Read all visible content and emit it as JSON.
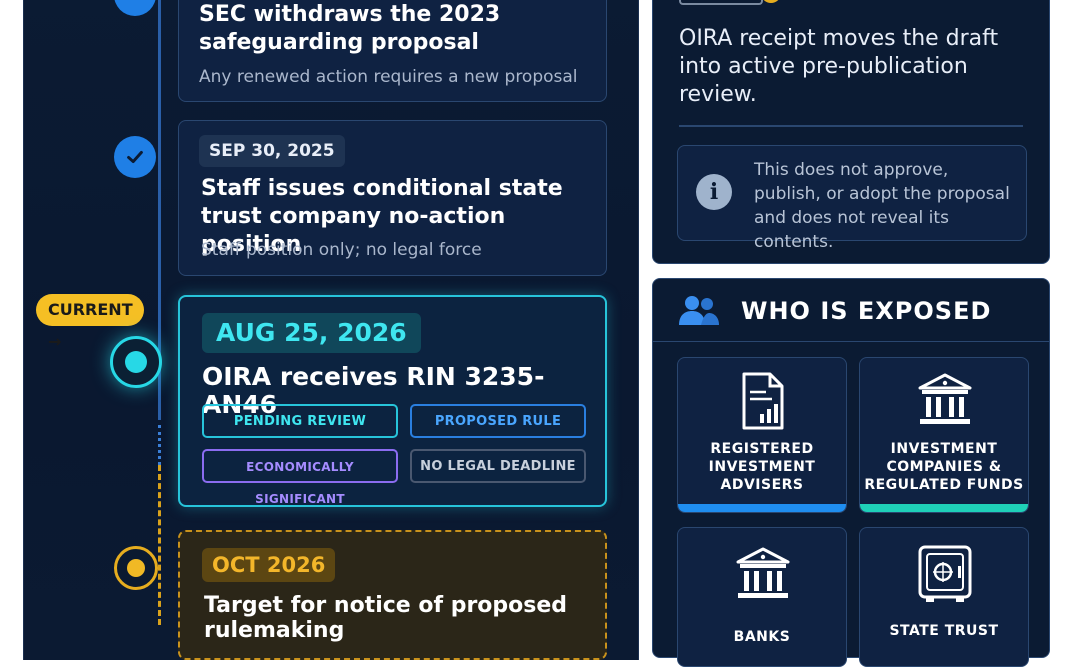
{
  "timeline": {
    "current_tag": "CURRENT →",
    "events": [
      {
        "title_line1": "SEC withdraws the 2023",
        "title_line2": "safeguarding proposal",
        "note": "Any renewed action requires a new proposal"
      },
      {
        "date": "SEP 30, 2025",
        "title_line1": "Staff issues conditional state",
        "title_line2": "trust company no-action position",
        "note": "Staff position only; no legal force"
      },
      {
        "date": "AUG 25, 2026",
        "title": "OIRA receives RIN 3235-AN46",
        "badges": [
          "PENDING REVIEW",
          "PROPOSED RULE",
          "ECONOMICALLY SIGNIFICANT",
          "NO LEGAL DEADLINE"
        ]
      },
      {
        "date": "OCT 2026",
        "title_line1": "Target for notice of proposed",
        "title_line2": "rulemaking"
      }
    ]
  },
  "oira_card": {
    "text_line1": "OIRA receipt moves the draft",
    "text_line2": "into active pre-publication",
    "text_line3": "review.",
    "notice_line1": "This does not approve,",
    "notice_line2": "publish, or adopt the proposal",
    "notice_line3": "and does not reveal its contents."
  },
  "exposed": {
    "heading": "WHO IS EXPOSED",
    "tiles": [
      {
        "line1": "REGISTERED",
        "line2": "INVESTMENT",
        "line3": "ADVISERS",
        "color": "#1f8ef0"
      },
      {
        "line1": "INVESTMENT",
        "line2": "COMPANIES &",
        "line3": "REGULATED FUNDS",
        "color": "#1fd1b8"
      },
      {
        "line1": "BANKS"
      },
      {
        "line1": "STATE TRUST"
      }
    ]
  },
  "colors": {
    "accent_blue": "#1f7fe6",
    "current_cyan": "#27d8e6",
    "future_amber": "#f0b925",
    "violet": "#8b6cf0"
  }
}
